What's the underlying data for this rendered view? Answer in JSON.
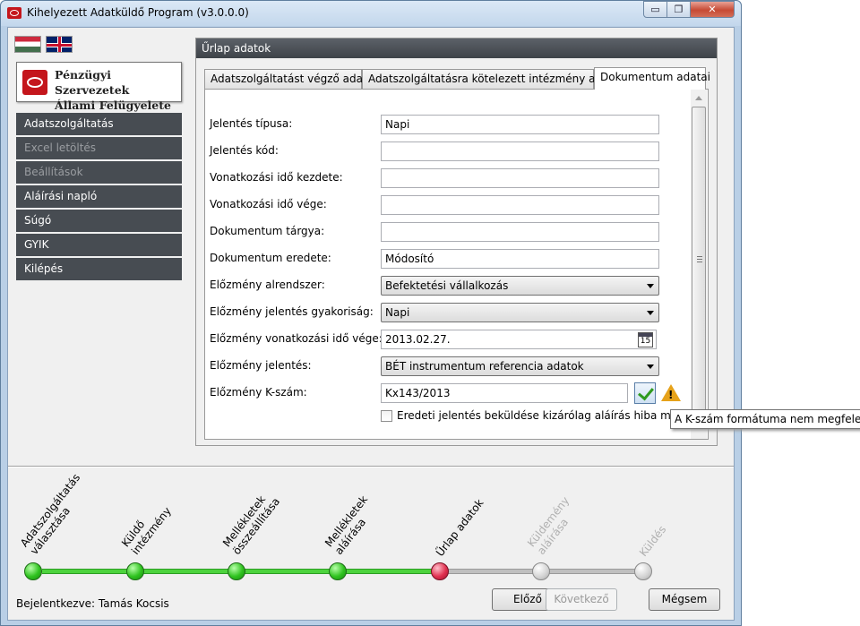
{
  "window": {
    "title": "Kihelyezett Adatküldő Program (v3.0.0.0)",
    "close_glyph": "✕",
    "min_glyph": "▭",
    "max_glyph": "❐"
  },
  "logo": {
    "line1": "Pénzügyi Szervezetek",
    "line2": "Állami Felügyelete"
  },
  "menu": [
    {
      "label": "Adatszolgáltatás",
      "enabled": true
    },
    {
      "label": "Excel letöltés",
      "enabled": false
    },
    {
      "label": "Beállítások",
      "enabled": false
    },
    {
      "label": "Aláírási napló",
      "enabled": true
    },
    {
      "label": "Súgó",
      "enabled": true
    },
    {
      "label": "GYIK",
      "enabled": true
    },
    {
      "label": "Kilépés",
      "enabled": true
    }
  ],
  "panel": {
    "title": "Űrlap adatok",
    "tabs": [
      {
        "label": "Adatszolgáltatást végző adatai",
        "active": false
      },
      {
        "label": "Adatszolgáltatásra kötelezett intézmény adatai",
        "active": false
      },
      {
        "label": "Dokumentum adatai",
        "active": true
      }
    ]
  },
  "form": {
    "fields": [
      {
        "label": "Jelentés típusa:",
        "value": "Napi",
        "kind": "text"
      },
      {
        "label": "Jelentés kód:",
        "value": "",
        "kind": "text"
      },
      {
        "label": "Vonatkozási idő kezdete:",
        "value": "",
        "kind": "text"
      },
      {
        "label": "Vonatkozási idő vége:",
        "value": "",
        "kind": "text"
      },
      {
        "label": "Dokumentum tárgya:",
        "value": "",
        "kind": "text"
      },
      {
        "label": "Dokumentum eredete:",
        "value": "Módosító",
        "kind": "text"
      },
      {
        "label": "Előzmény alrendszer:",
        "value": "Befektetési vállalkozás",
        "kind": "select"
      },
      {
        "label": "Előzmény jelentés gyakoriság:",
        "value": "Napi",
        "kind": "select"
      },
      {
        "label": "Előzmény vonatkozási idő vége:",
        "value": "2013.02.27.",
        "kind": "date"
      },
      {
        "label": "Előzmény jelentés:",
        "value": "BÉT instrumentum referencia adatok",
        "kind": "select"
      },
      {
        "label": "Előzmény K-szám:",
        "value": "Kx143/2013",
        "kind": "kszam"
      }
    ],
    "calendar_day": "15",
    "checkbox_label": "Eredeti jelentés beküldése kizárólag aláírás hiba miatt",
    "checkbox_checked": false,
    "warning_mark": "!",
    "tooltip": "A K-szám formátuma nem megfelelő!"
  },
  "steps": [
    {
      "label": "Adatszolgáltatás\nválasztása",
      "state": "done"
    },
    {
      "label": "Küldő\nintézmény",
      "state": "done"
    },
    {
      "label": "Mellékletek\nösszeállítása",
      "state": "done"
    },
    {
      "label": "Mellékletek\naláírása",
      "state": "done"
    },
    {
      "label": "Űrlap adatok",
      "state": "current"
    },
    {
      "label": "Küldemény\naláírása",
      "state": "todo"
    },
    {
      "label": "Küldés",
      "state": "todo"
    }
  ],
  "status": {
    "login_label": "Bejelentkezve:",
    "user": "Tamás Kocsis"
  },
  "buttons": {
    "prev": "Előző",
    "next": "Következő",
    "cancel": "Mégsem"
  }
}
